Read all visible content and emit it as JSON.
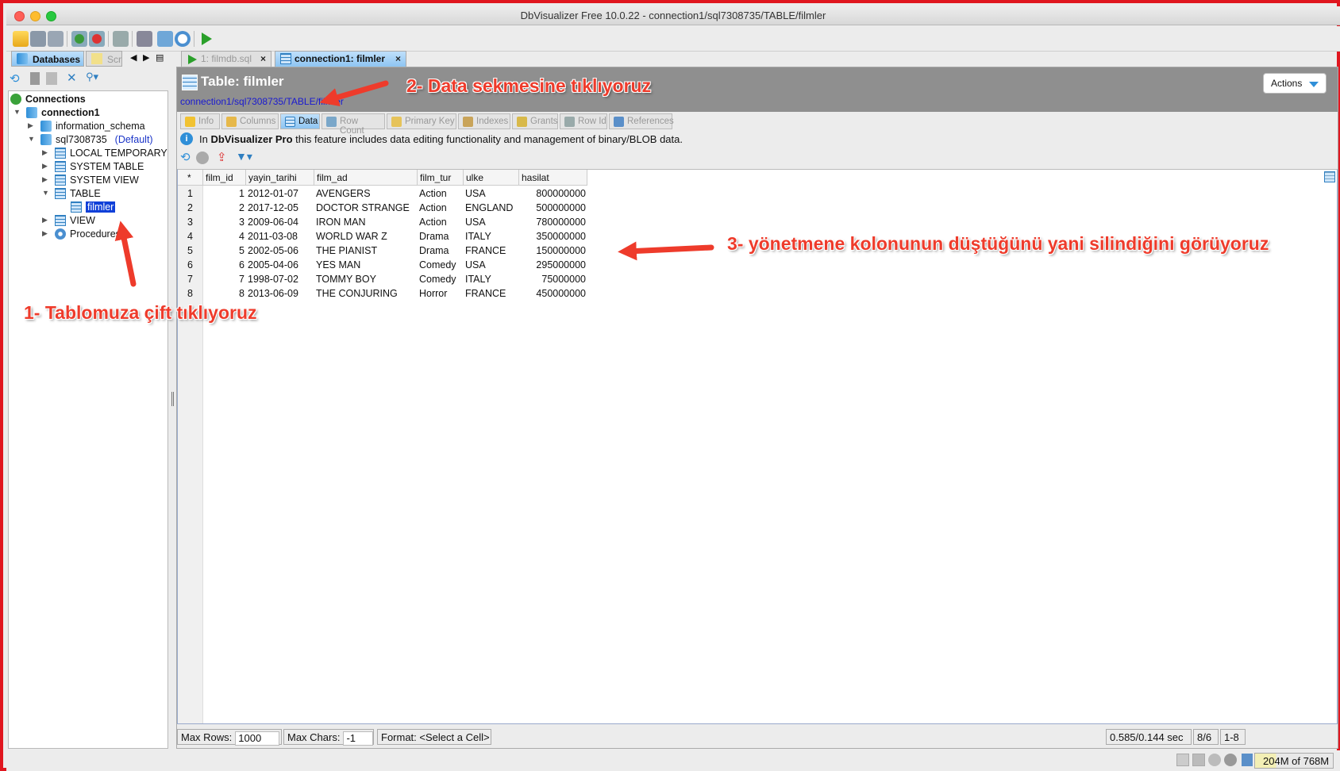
{
  "window": {
    "title": "DbVisualizer Free 10.0.22 - connection1/sql7308735/TABLE/filmler"
  },
  "left_tabs": {
    "databases": "Databases",
    "scripts": "Scrip"
  },
  "tree": {
    "root": "Connections",
    "connection": "connection1",
    "schema_info": "information_schema",
    "schema_main": "sql7308735",
    "schema_default": "(Default)",
    "local_temp": "LOCAL TEMPORARY",
    "system_table": "SYSTEM TABLE",
    "system_view": "SYSTEM VIEW",
    "table": "TABLE",
    "table_item": "filmler",
    "view": "VIEW",
    "procedures": "Procedures"
  },
  "editor_tabs": {
    "tab1": "1: filmdb.sql",
    "tab2": "connection1: filmler",
    "close": "×"
  },
  "object": {
    "title": "Table: filmler",
    "path": "connection1/sql7308735/TABLE/filmler",
    "actions": "Actions",
    "subtabs": [
      "Info",
      "Columns",
      "Data",
      "Row Count",
      "Primary Key",
      "Indexes",
      "Grants",
      "Row Id",
      "References"
    ]
  },
  "info": {
    "prefix": "In",
    "product": "DbVisualizer Pro",
    "text": "this feature includes data editing functionality and management of binary/BLOB data."
  },
  "grid": {
    "corner": "*",
    "columns": [
      "film_id",
      "yayin_tarihi",
      "film_ad",
      "film_tur",
      "ulke",
      "hasilat"
    ],
    "rows": [
      [
        "1",
        "2012-01-07",
        "AVENGERS",
        "Action",
        "USA",
        "800000000"
      ],
      [
        "2",
        "2017-12-05",
        "DOCTOR STRANGE",
        "Action",
        "ENGLAND",
        "500000000"
      ],
      [
        "3",
        "2009-06-04",
        "IRON MAN",
        "Action",
        "USA",
        "780000000"
      ],
      [
        "4",
        "2011-03-08",
        "WORLD WAR Z",
        "Drama",
        "ITALY",
        "350000000"
      ],
      [
        "5",
        "2002-05-06",
        "THE PIANIST",
        "Drama",
        "FRANCE",
        "150000000"
      ],
      [
        "6",
        "2005-04-06",
        "YES MAN",
        "Comedy",
        "USA",
        "295000000"
      ],
      [
        "7",
        "1998-07-02",
        "TOMMY BOY",
        "Comedy",
        "ITALY",
        "75000000"
      ],
      [
        "8",
        "2013-06-09",
        "THE CONJURING",
        "Horror",
        "FRANCE",
        "450000000"
      ]
    ],
    "row_numbers": [
      "1",
      "2",
      "3",
      "4",
      "5",
      "6",
      "7",
      "8"
    ]
  },
  "status": {
    "max_rows_label": "Max Rows:",
    "max_rows_value": "1000",
    "max_chars_label": "Max Chars:",
    "max_chars_value": "-1",
    "format": "Format: <Select a Cell>",
    "timing": "0.585/0.144 sec",
    "rows_ratio": "8/6",
    "range": "1-8"
  },
  "memory": "204M of 768M",
  "annotations": {
    "step1": "1- Tablomuza çift tıklıyoruz",
    "step2": "2- Data sekmesine tıklıyoruz",
    "step3": "3- yönetmene kolonunun düştüğünü yani silindiğini görüyoruz"
  },
  "colors": {
    "annotation": "#ee3b2b",
    "frame": "#e0161f",
    "selection": "#1040d8",
    "tab_active": "#8ec5f2"
  },
  "icons": [
    "open-folder-icon",
    "save-icon",
    "save-all-icon",
    "connect-icon",
    "disconnect-icon",
    "properties-icon",
    "tools-icon",
    "monitor-icon",
    "history-icon",
    "run-icon",
    "refresh-icon",
    "stop-icon",
    "export-icon",
    "filter-icon",
    "info-icon"
  ]
}
